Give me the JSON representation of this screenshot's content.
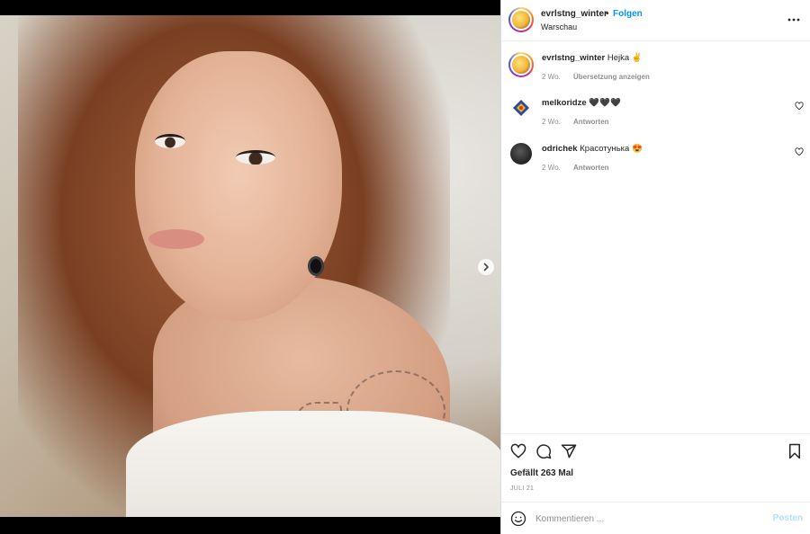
{
  "post": {
    "author": "evrlstng_winter",
    "follow_label": "Folgen",
    "separator": "•",
    "location": "Warschau",
    "accent_color": "#0095f6"
  },
  "comments": [
    {
      "username": "evrlstng_winter",
      "text": "Hejka ✌",
      "time": "2 Wo.",
      "action": "Übersetzung anzeigen"
    },
    {
      "username": "melkoridze",
      "text": "🖤🖤🖤",
      "time": "2 Wo.",
      "action": "Antworten"
    },
    {
      "username": "odrichek",
      "text": "Красотунька 😍",
      "time": "2 Wo.",
      "action": "Antworten"
    }
  ],
  "stats": {
    "likes": "Gefällt 263 Mal",
    "date": "JULI 21"
  },
  "composer": {
    "placeholder": "Kommentieren ...",
    "post_label": "Posten"
  },
  "carousel": {
    "slides": 2,
    "active_index": 0
  },
  "icons": {
    "more": "more-options-icon",
    "like": "heart-icon",
    "comment": "comment-icon",
    "share": "share-icon",
    "save": "bookmark-icon",
    "emoji": "emoji-icon",
    "next": "chevron-right-icon"
  }
}
